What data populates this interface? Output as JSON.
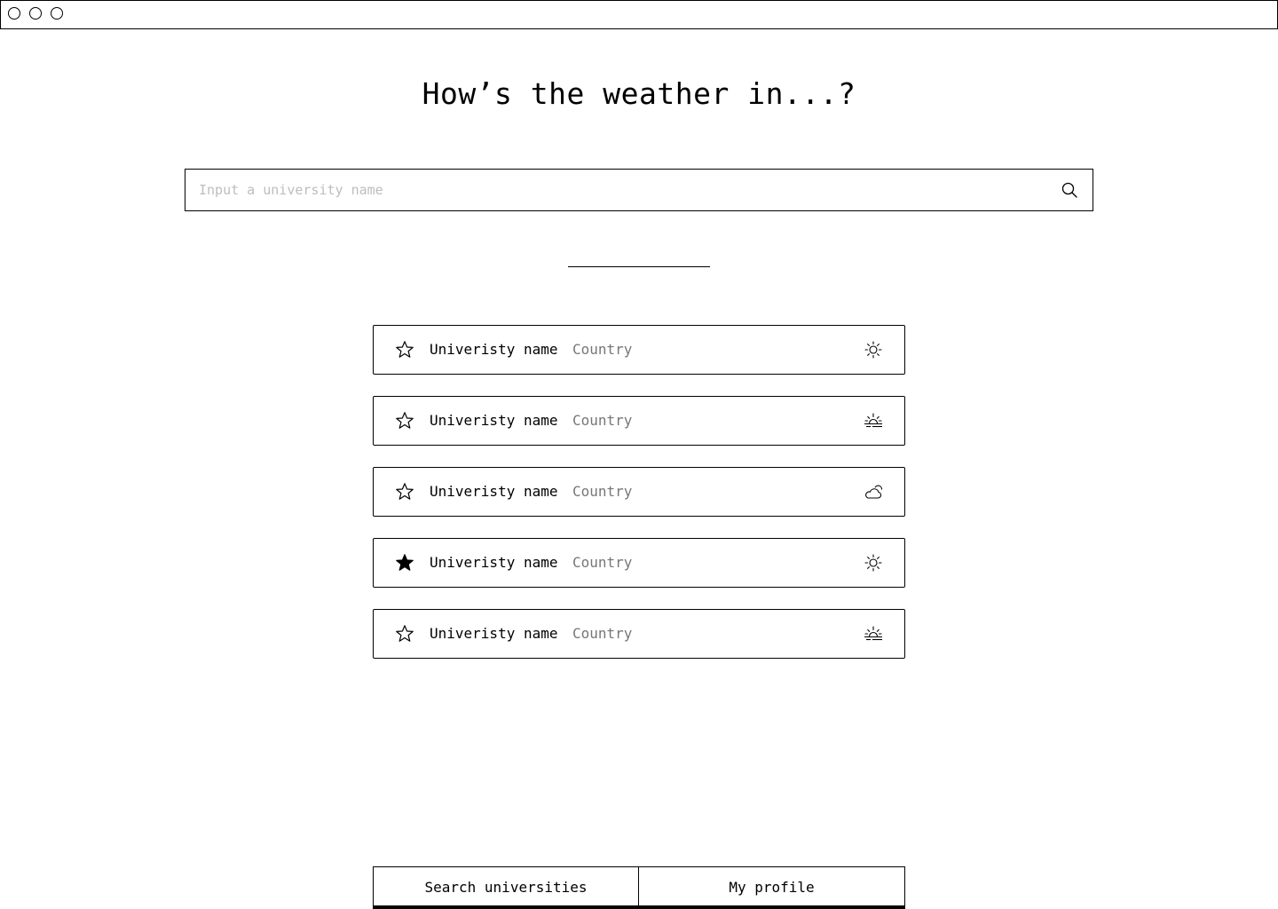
{
  "window": {
    "controls": [
      "close",
      "minimize",
      "maximize"
    ]
  },
  "header": {
    "title": "How’s the weather in...?"
  },
  "search": {
    "placeholder": "Input a university name",
    "value": "",
    "icon": "search-icon"
  },
  "results": [
    {
      "name": "Univeristy name",
      "country": "Country",
      "favorited": false,
      "weather": "sunny"
    },
    {
      "name": "Univeristy name",
      "country": "Country",
      "favorited": false,
      "weather": "sunrise"
    },
    {
      "name": "Univeristy name",
      "country": "Country",
      "favorited": false,
      "weather": "partly-cloudy"
    },
    {
      "name": "Univeristy name",
      "country": "Country",
      "favorited": true,
      "weather": "sunny"
    },
    {
      "name": "Univeristy name",
      "country": "Country",
      "favorited": false,
      "weather": "sunrise"
    }
  ],
  "nav": {
    "search_label": "Search universities",
    "profile_label": "My profile",
    "active": "search"
  },
  "colors": {
    "text": "#000000",
    "muted": "#777777",
    "placeholder": "#bdbdbd",
    "background": "#ffffff"
  }
}
